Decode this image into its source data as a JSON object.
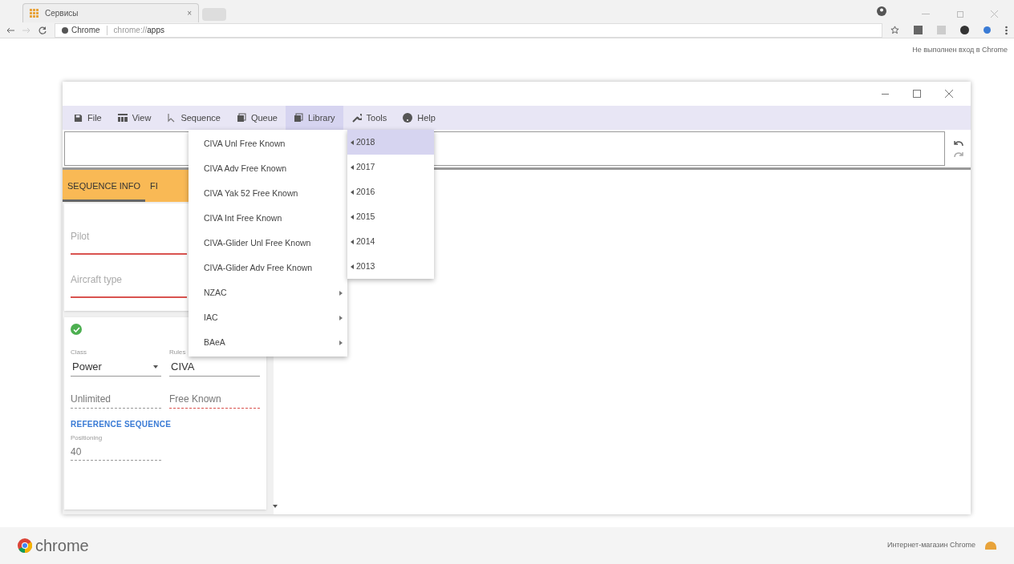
{
  "browser": {
    "tab_title": "Сервисы",
    "tab_close": "×",
    "site_chip": "Chrome",
    "url_prefix": "chrome://",
    "url_path": "apps",
    "signin_notice": "Не выполнен вход в Chrome"
  },
  "menubar": [
    {
      "label": "File",
      "open": false
    },
    {
      "label": "View",
      "open": false
    },
    {
      "label": "Sequence",
      "open": false
    },
    {
      "label": "Queue",
      "open": false
    },
    {
      "label": "Library",
      "open": true
    },
    {
      "label": "Tools",
      "open": false
    },
    {
      "label": "Help",
      "open": false
    }
  ],
  "panel_tabs": [
    {
      "label": "SEQUENCE INFO",
      "selected": true
    },
    {
      "label": "FI",
      "selected": false
    }
  ],
  "info_fields": [
    {
      "placeholder": "Pilot"
    },
    {
      "placeholder": "Aircraft type"
    }
  ],
  "class_field": {
    "label": "Class",
    "value": "Power"
  },
  "rules_field": {
    "label": "Rules",
    "value": "CIVA"
  },
  "category_field": {
    "value": "Unlimited"
  },
  "program_field": {
    "value": "Free Known"
  },
  "reference_heading": "REFERENCE SEQUENCE",
  "positioning_field": {
    "label": "Positioning",
    "value": "40"
  },
  "library_menu": [
    {
      "label": "2018",
      "selected": true
    },
    {
      "label": "2017",
      "selected": false
    },
    {
      "label": "2016",
      "selected": false
    },
    {
      "label": "2015",
      "selected": false
    },
    {
      "label": "2014",
      "selected": false
    },
    {
      "label": "2013",
      "selected": false
    }
  ],
  "submenu": [
    {
      "label": "CIVA Unl Free Known",
      "has_submenu": false
    },
    {
      "label": "CIVA Adv Free Known",
      "has_submenu": false
    },
    {
      "label": "CIVA Yak 52 Free Known",
      "has_submenu": false
    },
    {
      "label": "CIVA Int Free Known",
      "has_submenu": false
    },
    {
      "label": "CIVA-Glider Unl Free Known",
      "has_submenu": false
    },
    {
      "label": "CIVA-Glider Adv Free Known",
      "has_submenu": false
    },
    {
      "label": "NZAC",
      "has_submenu": true
    },
    {
      "label": "IAC",
      "has_submenu": true
    },
    {
      "label": "BAeA",
      "has_submenu": true
    }
  ],
  "footer": {
    "logo_text": "chrome",
    "store_link": "Интернет-магазин Chrome"
  }
}
